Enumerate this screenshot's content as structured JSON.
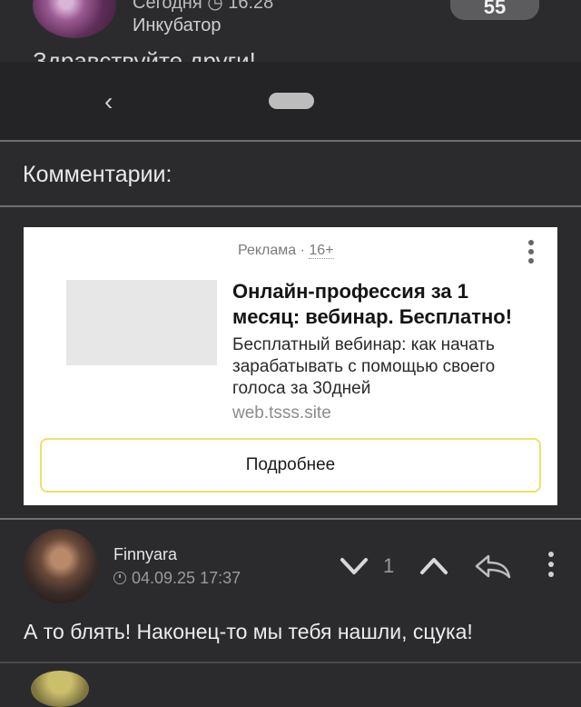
{
  "post": {
    "date": "Сегодня ◷ 16:28",
    "author": "Инкубатор",
    "badge": "55",
    "greeting": "Здравствуйте други!"
  },
  "nav": {
    "back_icon": "chevron-left-icon"
  },
  "comments_title": "Комментарии:",
  "ad": {
    "label": "Реклама",
    "age": "16+",
    "headline": "Онлайн-профессия за 1 месяц: вебинар. Бесплатно!",
    "description": "Бесплатный вебинар: как начать зарабатывать с помощью своего голоса за 30дней",
    "domain": "web.tsss.site",
    "cta": "Подробнее"
  },
  "comment": {
    "author": "Finnyara",
    "date": "04.09.25 17:37",
    "votes": "1",
    "text": "А то блять! Наконец-то мы тебя нашли, сцука!"
  },
  "colors": {
    "background": "#2b2b2d",
    "cta_border": "#f0e06a"
  }
}
